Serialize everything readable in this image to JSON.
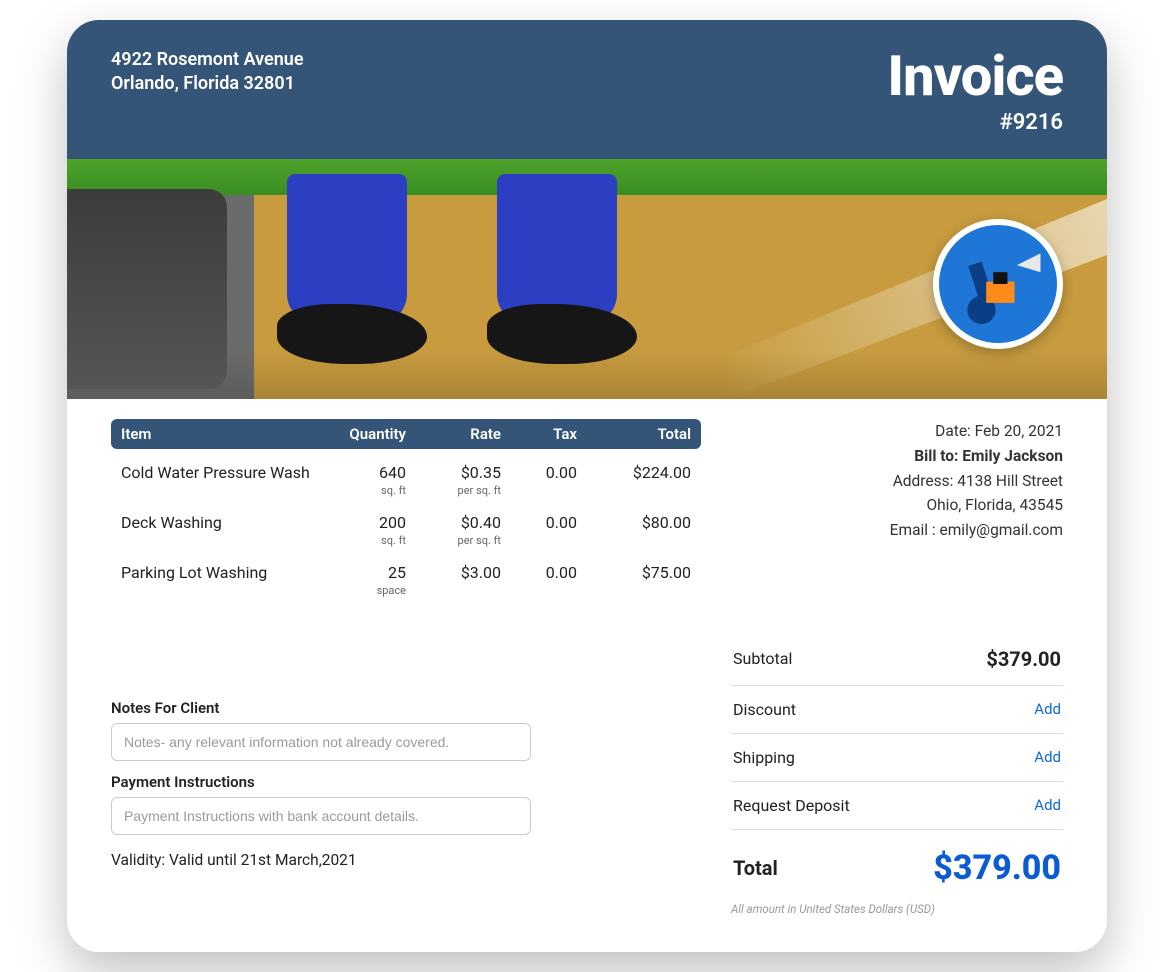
{
  "header": {
    "from_line1": "4922 Rosemont Avenue",
    "from_line2": "Orlando, Florida 32801",
    "title": "Invoice",
    "number": "#9216"
  },
  "billing": {
    "date_label": "Date: Feb 20, 2021",
    "bill_to": "Bill to: Emily Jackson",
    "address_line1": "Address: 4138 Hill Street",
    "address_line2": "Ohio, Florida, 43545",
    "email": "Email : emily@gmail.com"
  },
  "columns": {
    "item": "Item",
    "qty": "Quantity",
    "rate": "Rate",
    "tax": "Tax",
    "total": "Total"
  },
  "lines": [
    {
      "item": "Cold Water Pressure Wash",
      "qty": "640",
      "qty_unit": "sq. ft",
      "rate": "$0.35",
      "rate_unit": "per sq. ft",
      "tax": "0.00",
      "total": "$224.00"
    },
    {
      "item": "Deck Washing",
      "qty": "200",
      "qty_unit": "sq. ft",
      "rate": "$0.40",
      "rate_unit": "per sq. ft",
      "tax": "0.00",
      "total": "$80.00"
    },
    {
      "item": "Parking Lot Washing",
      "qty": "25",
      "qty_unit": "space",
      "rate": "$3.00",
      "rate_unit": "",
      "tax": "0.00",
      "total": "$75.00"
    }
  ],
  "totals": {
    "subtotal_label": "Subtotal",
    "subtotal": "$379.00",
    "discount_label": "Discount",
    "discount_action": "Add",
    "shipping_label": "Shipping",
    "shipping_action": "Add",
    "deposit_label": "Request Deposit",
    "deposit_action": "Add",
    "total_label": "Total",
    "total": "$379.00",
    "currency_note": "All amount in United States Dollars (USD)"
  },
  "notes": {
    "notes_label": "Notes For Client",
    "notes_placeholder": "Notes- any relevant information not already covered.",
    "payment_label": "Payment Instructions",
    "payment_placeholder": "Payment Instructions with bank account details.",
    "validity": "Validity: Valid until 21st March,2021"
  }
}
